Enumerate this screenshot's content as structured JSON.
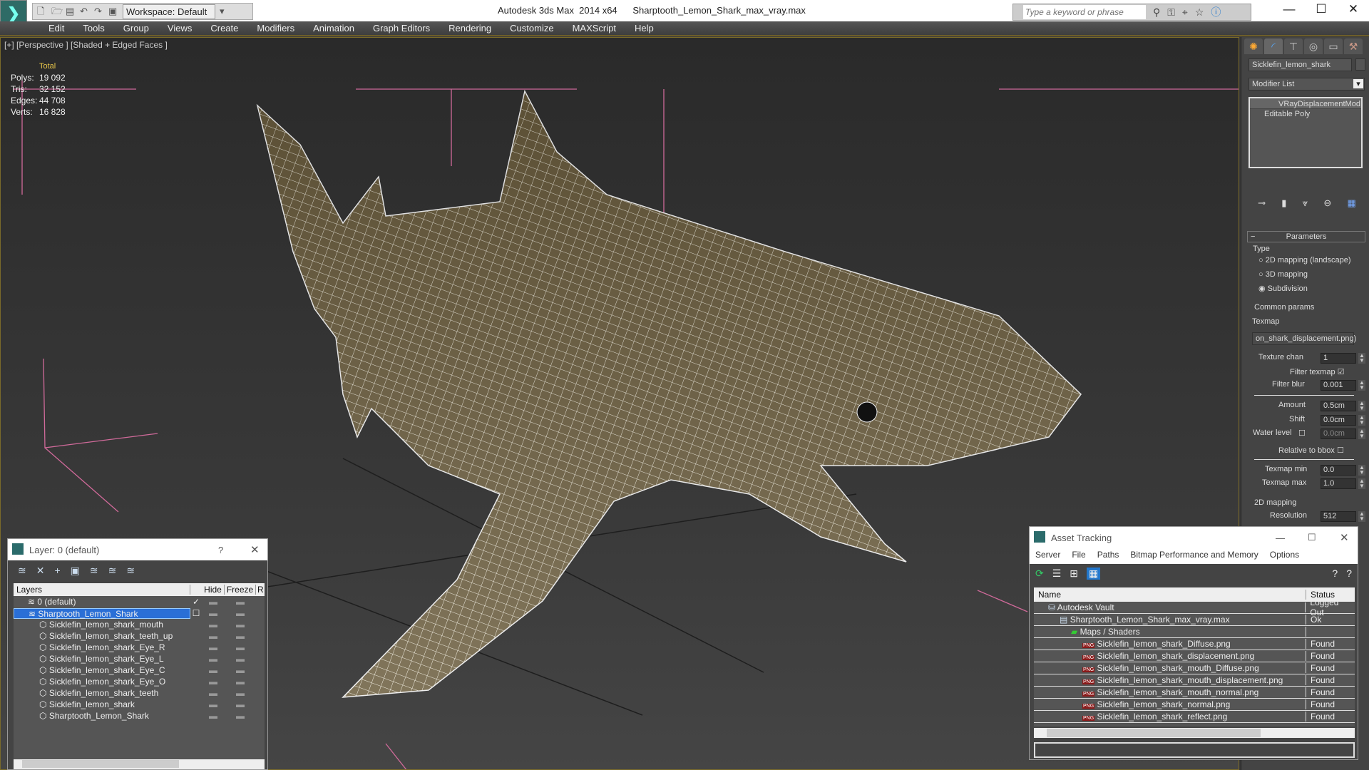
{
  "titlebar": {
    "app": "Autodesk 3ds Max  2014 x64",
    "file": "Sharptooth_Lemon_Shark_max_vray.max",
    "workspace": "Workspace: Default",
    "search_placeholder": "Type a keyword or phrase"
  },
  "menu": [
    "Edit",
    "Tools",
    "Group",
    "Views",
    "Create",
    "Modifiers",
    "Animation",
    "Graph Editors",
    "Rendering",
    "Customize",
    "MAXScript",
    "Help"
  ],
  "viewport": {
    "label": "[+] [Perspective ] [Shaded + Edged Faces ]",
    "stats_header": "Total",
    "stats": [
      {
        "k": "Polys:",
        "v": "19 092"
      },
      {
        "k": "Tris:",
        "v": "32 152"
      },
      {
        "k": "Edges:",
        "v": "44 708"
      },
      {
        "k": "Verts:",
        "v": "16 828"
      }
    ]
  },
  "command_panel": {
    "object_name": "Sicklefin_lemon_shark",
    "modifier_list": "Modifier List",
    "stack": [
      "VRayDisplacementMod",
      "Editable Poly"
    ],
    "rollout": "Parameters",
    "type_group": "Type",
    "types": [
      "2D mapping (landscape)",
      "3D mapping",
      "Subdivision"
    ],
    "selected_type": 2,
    "common_group": "Common params",
    "texmap_label": "Texmap",
    "texmap": "on_shark_displacement.png)",
    "fields": [
      {
        "label": "Texture chan",
        "value": "1"
      },
      {
        "label": "Filter blur",
        "value": "0.001"
      },
      {
        "label": "Amount",
        "value": "0.5cm"
      },
      {
        "label": "Shift",
        "value": "0.0cm"
      },
      {
        "label": "Water level",
        "value": "0.0cm"
      },
      {
        "label": "Texmap min",
        "value": "0.0"
      },
      {
        "label": "Texmap max",
        "value": "1.0"
      },
      {
        "label": "Resolution",
        "value": "512"
      }
    ],
    "filter_texmap": "Filter texmap",
    "relative_bbox": "Relative to bbox",
    "mapping_group": "2D mapping"
  },
  "layer_dialog": {
    "title": "Layer: 0 (default)",
    "help": "?",
    "columns": [
      "Layers",
      "Hide",
      "Freeze",
      "R"
    ],
    "layers": [
      {
        "name": "0 (default)",
        "level": 0
      },
      {
        "name": "Sharptooth_Lemon_Shark",
        "level": 0,
        "selected": true
      },
      {
        "name": "Sicklefin_lemon_shark_mouth",
        "level": 1
      },
      {
        "name": "Sicklefin_lemon_shark_teeth_up",
        "level": 1
      },
      {
        "name": "Sicklefin_lemon_shark_Eye_R",
        "level": 1
      },
      {
        "name": "Sicklefin_lemon_shark_Eye_L",
        "level": 1
      },
      {
        "name": "Sicklefin_lemon_shark_Eye_C",
        "level": 1
      },
      {
        "name": "Sicklefin_lemon_shark_Eye_O",
        "level": 1
      },
      {
        "name": "Sicklefin_lemon_shark_teeth",
        "level": 1
      },
      {
        "name": "Sicklefin_lemon_shark",
        "level": 1
      },
      {
        "name": "Sharptooth_Lemon_Shark",
        "level": 1
      }
    ]
  },
  "asset_tracking": {
    "title": "Asset Tracking",
    "menu": [
      "Server",
      "File",
      "Paths",
      "Bitmap Performance and Memory",
      "Options"
    ],
    "columns": [
      "Name",
      "Status"
    ],
    "rows": [
      {
        "name": "Autodesk Vault",
        "status": "Logged Out",
        "level": 0
      },
      {
        "name": "Sharptooth_Lemon_Shark_max_vray.max",
        "status": "Ok",
        "level": 1
      },
      {
        "name": "Maps / Shaders",
        "status": "",
        "level": 2
      },
      {
        "name": "Sicklefin_lemon_shark_Diffuse.png",
        "status": "Found",
        "level": 3
      },
      {
        "name": "Sicklefin_lemon_shark_displacement.png",
        "status": "Found",
        "level": 3
      },
      {
        "name": "Sicklefin_lemon_shark_mouth_Diffuse.png",
        "status": "Found",
        "level": 3
      },
      {
        "name": "Sicklefin_lemon_shark_mouth_displacement.png",
        "status": "Found",
        "level": 3
      },
      {
        "name": "Sicklefin_lemon_shark_mouth_normal.png",
        "status": "Found",
        "level": 3
      },
      {
        "name": "Sicklefin_lemon_shark_normal.png",
        "status": "Found",
        "level": 3
      },
      {
        "name": "Sicklefin_lemon_shark_reflect.png",
        "status": "Found",
        "level": 3
      }
    ]
  }
}
